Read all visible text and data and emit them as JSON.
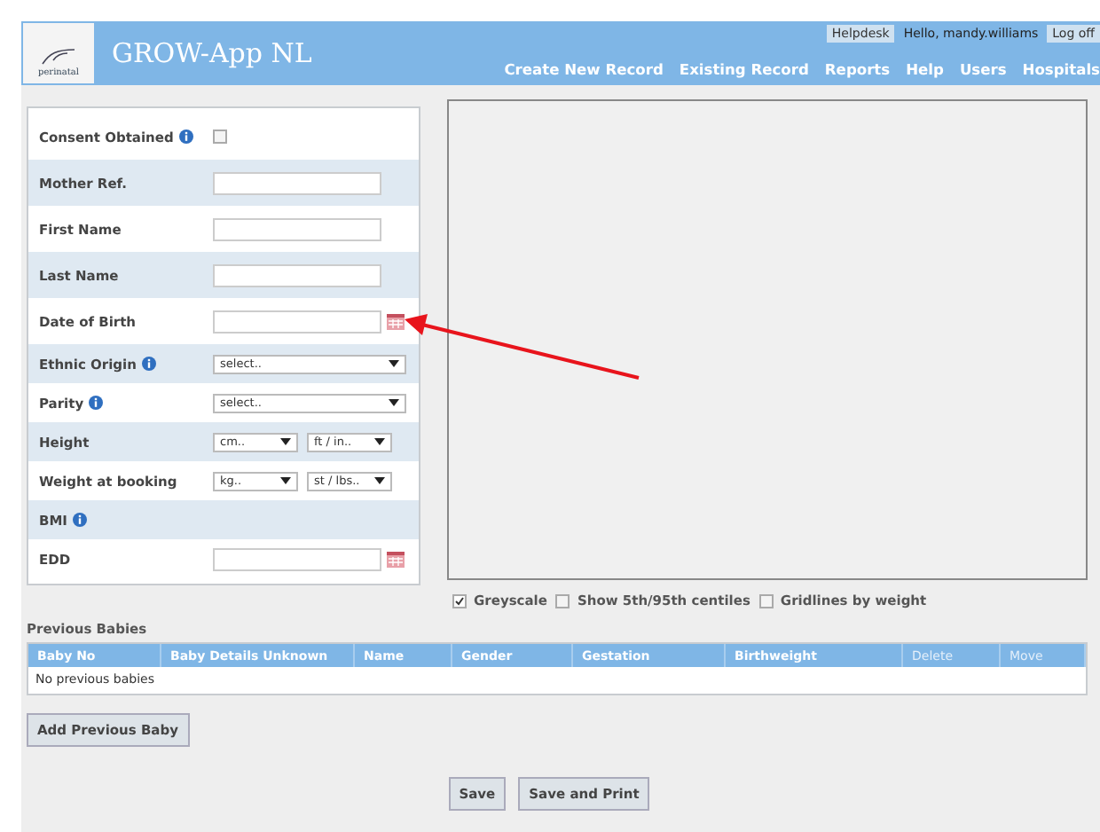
{
  "header": {
    "title": "GROW-App NL",
    "logo_text": "perinatal",
    "top_links": [
      {
        "label": "Helpdesk",
        "kind": "button"
      },
      {
        "label": "Hello, mandy.williams",
        "kind": "text"
      },
      {
        "label": "Log off",
        "kind": "button"
      }
    ],
    "nav": [
      "Create New Record",
      "Existing Record",
      "Reports",
      "Help",
      "Users",
      "Hospitals"
    ]
  },
  "form": [
    {
      "label": "Consent Obtained",
      "info": true,
      "kind": "checkbox",
      "checked": false
    },
    {
      "label": "Mother Ref.",
      "info": false,
      "kind": "text"
    },
    {
      "label": "First Name",
      "info": false,
      "kind": "text"
    },
    {
      "label": "Last Name",
      "info": false,
      "kind": "text"
    },
    {
      "label": "Date of Birth",
      "info": false,
      "kind": "date"
    },
    {
      "label": "Ethnic Origin",
      "info": true,
      "kind": "select",
      "options": [
        "select.."
      ]
    },
    {
      "label": "Parity",
      "info": true,
      "kind": "select",
      "options": [
        "select.."
      ]
    },
    {
      "label": "Height",
      "info": false,
      "kind": "pair",
      "options": [
        "cm..",
        "ft / in.."
      ]
    },
    {
      "label": "Weight at booking",
      "info": false,
      "kind": "pair",
      "options": [
        "kg..",
        "st / lbs.."
      ]
    },
    {
      "label": "BMI",
      "info": true,
      "kind": "none"
    },
    {
      "label": "EDD",
      "info": false,
      "kind": "date"
    }
  ],
  "chart_options": [
    {
      "label": "Greyscale",
      "checked": true
    },
    {
      "label": "Show 5th/95th centiles",
      "checked": false
    },
    {
      "label": "Gridlines by weight",
      "checked": false
    }
  ],
  "previous_babies": {
    "title": "Previous Babies",
    "columns": [
      {
        "label": "Baby No",
        "muted": false
      },
      {
        "label": "Baby Details Unknown",
        "muted": false
      },
      {
        "label": "Name",
        "muted": false
      },
      {
        "label": "Gender",
        "muted": false
      },
      {
        "label": "Gestation",
        "muted": false
      },
      {
        "label": "Birthweight",
        "muted": false
      },
      {
        "label": "Delete",
        "muted": true
      },
      {
        "label": "Move",
        "muted": true
      }
    ],
    "empty_text": "No previous babies",
    "add_button": "Add Previous Baby"
  },
  "buttons": [
    "Save",
    "Save and Print"
  ]
}
